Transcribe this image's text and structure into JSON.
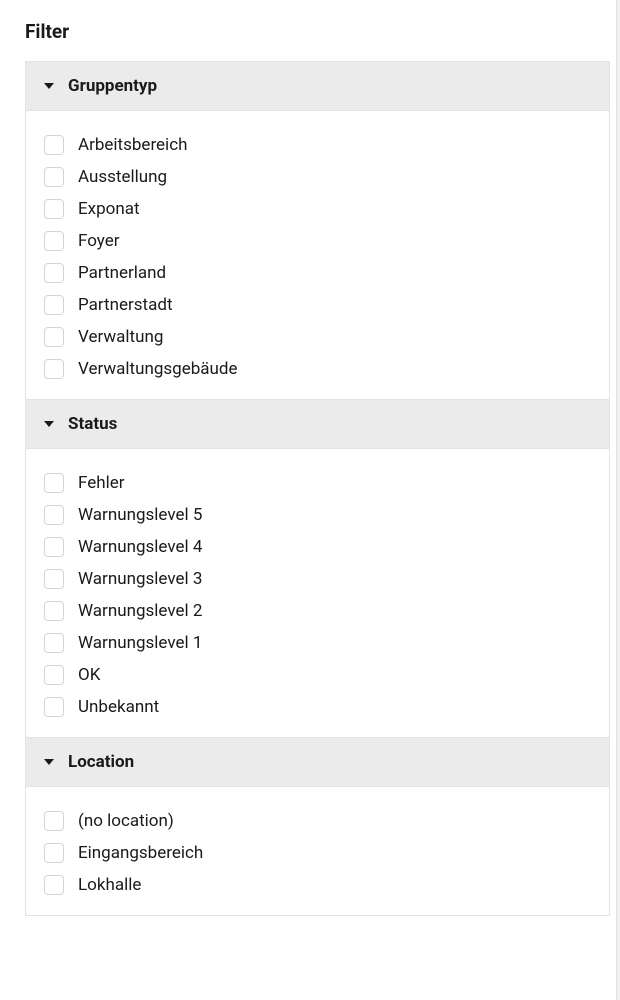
{
  "filter": {
    "title": "Filter",
    "sections": [
      {
        "title": "Gruppentyp",
        "items": [
          "Arbeitsbereich",
          "Ausstellung",
          "Exponat",
          "Foyer",
          "Partnerland",
          "Partnerstadt",
          "Verwaltung",
          "Verwaltungsgebäude"
        ]
      },
      {
        "title": "Status",
        "items": [
          "Fehler",
          "Warnungslevel 5",
          "Warnungslevel 4",
          "Warnungslevel 3",
          "Warnungslevel 2",
          "Warnungslevel 1",
          "OK",
          "Unbekannt"
        ]
      },
      {
        "title": "Location",
        "items": [
          "(no location)",
          "Eingangsbereich",
          "Lokhalle"
        ]
      }
    ]
  }
}
